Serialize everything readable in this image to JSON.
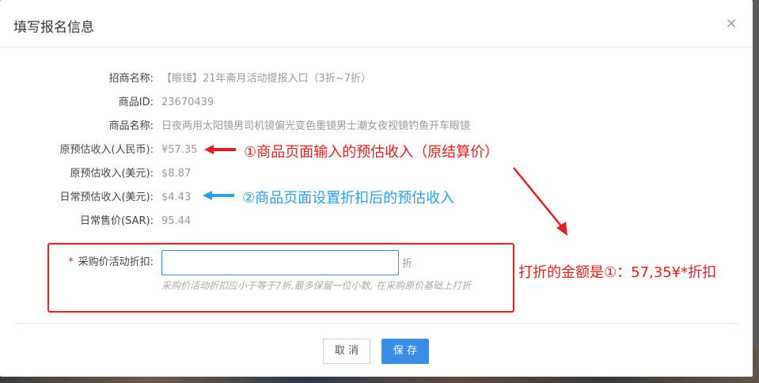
{
  "dialog": {
    "title": "填写报名信息",
    "close_label": "×"
  },
  "fields": [
    {
      "label": "招商名称:",
      "value": "【眼镜】21年斋月活动提报入口（3折~7折）"
    },
    {
      "label": "商品ID:",
      "value": "23670439"
    },
    {
      "label": "商品名称:",
      "value": "日夜两用太阳镜男司机镜偏光变色墨镜男士潮女夜视镜钓鱼开车眼镜"
    },
    {
      "label": "原预估收入(人民币):",
      "value": "¥57.35"
    },
    {
      "label": "原预估收入(美元):",
      "value": "$8.87"
    },
    {
      "label": "日常预估收入(美元):",
      "value": "$4.43"
    },
    {
      "label": "日常售价(SAR):",
      "value": "95.44"
    }
  ],
  "discount": {
    "required_mark": "*",
    "label": "采购价活动折扣:",
    "value": "",
    "placeholder": "",
    "unit": "折",
    "hint": "采购价活动折扣应小于等于7折,最多保留一位小数, 在采购原价基础上打折"
  },
  "annotations": {
    "note1": "①商品页面输入的预估收入（原结算价）",
    "note2": "②商品页面设置折扣后的预估收入",
    "note3": "打折的金额是①：57,35¥*折扣",
    "note1_color": "#e02020",
    "note2_color": "#2a9fe8",
    "note3_color": "#e02020"
  },
  "footer": {
    "cancel_label": "取 消",
    "save_label": "保 存"
  },
  "colors": {
    "accent": "#3a8ee6",
    "annotation_red": "#e02020",
    "annotation_blue": "#2a9fe8"
  }
}
